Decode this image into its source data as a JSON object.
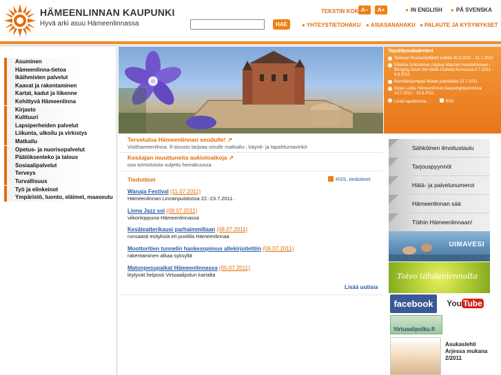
{
  "header": {
    "brand_title": "HÄMEENLINNAN KAUPUNKI",
    "brand_slogan": "Hyvä arki asuu Hämeenlinnassa",
    "textsize_label": "TEKSTIN KOKO",
    "size_minus": "A−",
    "size_plus": "A+",
    "lang_en": "IN ENGLISH",
    "lang_sv": "PÅ SVENSKA",
    "search_placeholder": "",
    "search_button": "HAE",
    "links": {
      "contact": "YHTEYSTIETOHAKU",
      "index": "ASIASANAHAKU",
      "feedback": "PALAUTE JA KYSYMYKSET"
    },
    "accent_color": "#f07f14"
  },
  "nav": {
    "items": [
      "Asuminen",
      "Hämeenlinna-tietoa",
      "Ikäihmisten palvelut",
      "Kaavat ja rakentaminen",
      "Kartat, kadut ja liikenne",
      "Kehittyvä Hämeenlinna",
      "Kirjasto",
      "Kulttuuri",
      "Lapsiperheiden palvelut",
      "Liikunta, ulkoilu ja virkistys",
      "Matkailu",
      "Opetus- ja nuorisopalvelut",
      "Päätöksenteko ja talous",
      "Sosiaalipalvelut",
      "Terveys",
      "Turvallisuus",
      "Työ ja elinkeinot",
      "Ympäristö, luonto, eläimet, maaseutu"
    ]
  },
  "events": {
    "title": "Tapahtumakalenteri",
    "items": [
      "Teoksen Ruutanäyttämö esittää 30.6.2011 - 31.7.2011",
      "Edelina Goldstonen näytely Maurien muistelmineen - Bringing Down the Walls Galleria Konsessa 9.7.2011 - 6.8.2011",
      "Nurmikkojumppa Iittalan palotalolla 13.7.2011",
      "Kirjan Lahja Hämeenlinnan kaupunginpuistossa 14.7.2011 - 13.8.2011"
    ],
    "more": "Lisää tapahtumia...",
    "rss": "RSS"
  },
  "main": {
    "welcome_title": "Tervetuloa Hämeenlinnan seudulle!",
    "welcome_text": "Visithameenlinna. fi-sivusto tarjoaa sinulle matkailu-, käynti- ja tapahtumavinkit",
    "summer_title": "Kesäajan muuttuneita aukioloaikoja",
    "summer_text": "osa toimistoista suljettu heinäkuussa",
    "news_title": "Tiedotteet",
    "rss_label": "RSS, tiedotteet",
    "news": [
      {
        "title": "Wanaja Festival",
        "date": "(11.07.2011)",
        "desc": "Hämeenlinnan Linnanpuistossa 22.-23.7.2011."
      },
      {
        "title": "Linna Jazz soi",
        "date": "(08.07.2011)",
        "desc": "viikonloppuna Hämeenlinnassa"
      },
      {
        "title": "Kesäteatterikausi parhaimmillaan",
        "date": "(08.07.2011)",
        "desc": "runsaasti esityksiä eri puolilla Hämeenlinnaa"
      },
      {
        "title": "Moottoritien tunnelin hankesopimus allekirjoitettiin",
        "date": "(06.07.2011)",
        "desc": "rakentaminen alkaa syksyllä"
      },
      {
        "title": "Matonpesupaikat Hämeenlinnassa",
        "date": "(05.07.2011)",
        "desc": "löytyvät helposti Virtuaalipolun kartalta"
      }
    ],
    "more_news": "Lisää uutisia"
  },
  "sidebar": {
    "buttons": [
      "Sähköinen ilmoitustaulu",
      "Tarjouspyynnöt",
      "Hätä- ja palvelunumerot",
      "Hämeenlinnan sää",
      "Töihin Hämeenlinnaan!"
    ],
    "uimavesi": "UIMAVESI",
    "toivo": "Toivo tähdenlennolta",
    "facebook": "facebook",
    "youtube_you": "You",
    "youtube_tube": "Tube",
    "virtuaalipolku": "Virtuaalipolku.fi",
    "magazine": "Asukaslehti Arjessa mukana 2/2011"
  }
}
